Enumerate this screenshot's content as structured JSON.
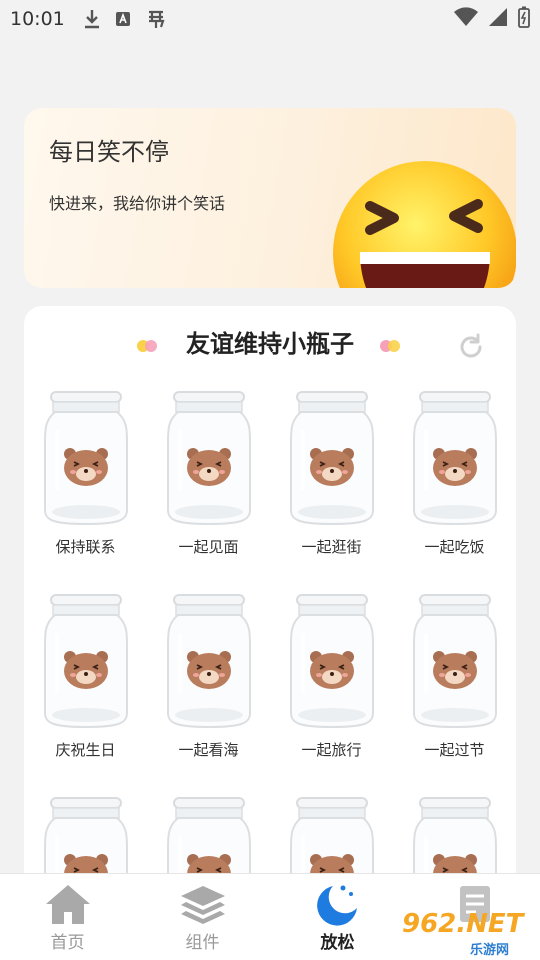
{
  "status_bar": {
    "time": "10:01",
    "left_icons": [
      "download-icon",
      "a-box-icon",
      "bug-icon"
    ],
    "right_icons": [
      "wifi-icon",
      "signal-icon",
      "battery-charging-icon"
    ]
  },
  "joke_card": {
    "title": "每日笑不停",
    "subtitle": "快进来，我给你讲个笑话",
    "emoji_icon": "laughing-face-emoji"
  },
  "jar_panel": {
    "title": "友谊维持小瓶子",
    "refresh_icon": "refresh-icon",
    "jars": [
      {
        "label": "保持联系"
      },
      {
        "label": "一起见面"
      },
      {
        "label": "一起逛街"
      },
      {
        "label": "一起吃饭"
      },
      {
        "label": "庆祝生日"
      },
      {
        "label": "一起看海"
      },
      {
        "label": "一起旅行"
      },
      {
        "label": "一起过节"
      },
      {
        "label": ""
      },
      {
        "label": ""
      },
      {
        "label": ""
      },
      {
        "label": ""
      }
    ]
  },
  "bottom_nav": {
    "items": [
      {
        "label": "首页",
        "icon": "home-icon",
        "active": false
      },
      {
        "label": "组件",
        "icon": "layers-icon",
        "active": false
      },
      {
        "label": "放松",
        "icon": "moon-icon",
        "active": true
      },
      {
        "label": "",
        "icon": "edit-icon",
        "active": false
      }
    ]
  },
  "watermark": {
    "brand": "962.NET",
    "caption": "乐游网"
  },
  "colors": {
    "accent_blue": "#1e7be0",
    "card_bg": "#fdf0de",
    "dot_pink": "#f7a1b9",
    "dot_yellow": "#f9d24a"
  }
}
